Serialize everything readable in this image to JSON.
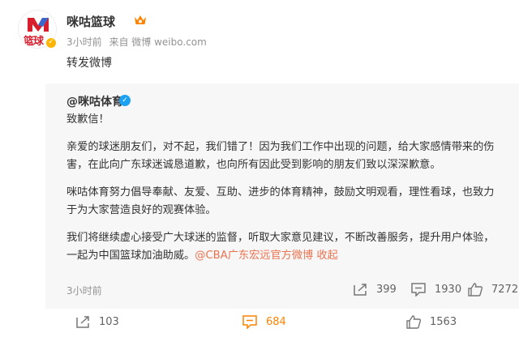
{
  "post": {
    "author": "咪咕篮球",
    "avatar_text": "篮球",
    "time": "3小时前",
    "source": "来自 微博 weibo.com",
    "text": "转发微博",
    "actions": {
      "repost_count": "103",
      "comment_count": "684",
      "like_count": "1563"
    }
  },
  "retweet": {
    "author": "@咪咕体育",
    "paragraphs": [
      "致歉信！",
      "亲爱的球迷朋友们，对不起，我们错了！因为我们工作中出现的问题，给大家感情带来的伤害，在此向广东球迷诚恳道歉，也向所有因此受到影响的朋友们致以深深歉意。",
      "咪咕体育努力倡导奉献、友爱、互助、进步的体育精神，鼓励文明观看，理性看球，也致力于为大家营造良好的观赛体验。"
    ],
    "last_paragraph": "我们将继续虚心接受广大球迷的监督，听取大家意见建议，不断改善服务，提升用户体验，一起为中国篮球加油助威。",
    "mention_link": "@CBA广东宏远官方微博",
    "collapse_link": "收起",
    "time": "3小时前",
    "stats": {
      "repost_count": "399",
      "comment_count": "1930",
      "like_count": "7272"
    }
  },
  "colors": {
    "accent_orange": "#ff8200",
    "link": "#eb7350",
    "verified_blue": "#1da1f2",
    "verified_gold": "#ffb400"
  }
}
